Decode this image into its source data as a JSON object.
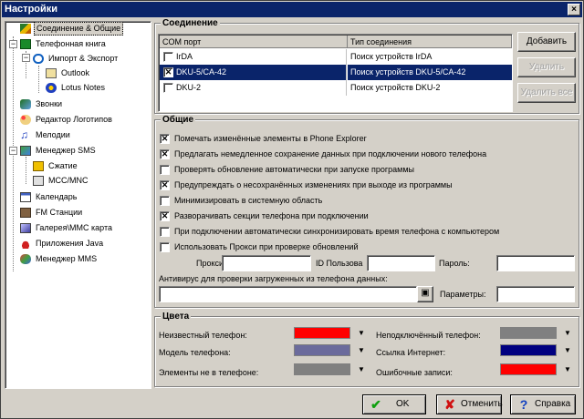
{
  "window": {
    "title": "Настройки",
    "close_glyph": "×"
  },
  "tree": {
    "items": [
      {
        "label": "Соединение & Общие",
        "icon": "pen-icon",
        "selected": true
      },
      {
        "label": "Телефонная книга",
        "icon": "phonebook-icon"
      },
      {
        "label": "Импорт & Экспорт",
        "icon": "import-export-icon"
      },
      {
        "label": "Outlook",
        "icon": "outlook-icon"
      },
      {
        "label": "Lotus Notes",
        "icon": "lotus-notes-icon"
      },
      {
        "label": "Звонки",
        "icon": "calls-icon"
      },
      {
        "label": "Редактор Логотипов",
        "icon": "palette-icon"
      },
      {
        "label": "Мелодии",
        "icon": "music-note-icon"
      },
      {
        "label": "Менеджер SMS",
        "icon": "sms-icon"
      },
      {
        "label": "Сжатие",
        "icon": "compression-icon"
      },
      {
        "label": "MCC/MNC",
        "icon": "monitor-icon"
      },
      {
        "label": "Календарь",
        "icon": "calendar-icon"
      },
      {
        "label": "FM Станции",
        "icon": "radio-icon"
      },
      {
        "label": "Галерея\\MMC карта",
        "icon": "gallery-icon"
      },
      {
        "label": "Приложения Java",
        "icon": "java-cup-icon"
      },
      {
        "label": "Менеджер MMS",
        "icon": "mms-icon"
      }
    ],
    "expander_minus": "−"
  },
  "connection": {
    "title": "Соединение",
    "columns": [
      "COM порт",
      "Тип соединения"
    ],
    "rows": [
      {
        "port": "IrDA",
        "type": "Поиск устройств IrDA",
        "checked": false,
        "selected": false
      },
      {
        "port": "DKU-5/CA-42",
        "type": "Поиск устройств DKU-5/CA-42",
        "checked": true,
        "selected": true
      },
      {
        "port": "DKU-2",
        "type": "Поиск устройств DKU-2",
        "checked": false,
        "selected": false
      }
    ],
    "buttons": {
      "add": "Добавить",
      "delete": "Удалить",
      "delete_all": "Удалить все"
    }
  },
  "general": {
    "title": "Общие",
    "options": [
      {
        "label": "Помечать изменённые элементы в Phone Explorer",
        "checked": true
      },
      {
        "label": "Предлагать немедленное сохранение данных при подключении нового телефона",
        "checked": true
      },
      {
        "label": "Проверять обновление автоматически при запуске программы",
        "checked": false
      },
      {
        "label": "Предупреждать о несохранённых изменениях при выходе из программы",
        "checked": true
      },
      {
        "label": "Минимизировать в системную область",
        "checked": false
      },
      {
        "label": "Разворачивать секции телефона при подключении",
        "checked": true
      },
      {
        "label": "При подключении автоматически синхронизировать время телефона с компьютером",
        "checked": false
      },
      {
        "label": "Использовать Прокси при проверке обновлений",
        "checked": false
      }
    ],
    "check_glyph": "✕",
    "proxy": {
      "proxy_label": "Прокси:",
      "id_label": "ID Пользова",
      "password_label": "Пароль:",
      "proxy_value": "",
      "id_value": "",
      "password_value": ""
    },
    "antivirus": {
      "label": "Антивирус для проверки загруженных из телефона данных:",
      "value": "",
      "params_label": "Параметры:",
      "params_value": "",
      "browse_icon": "folder-icon"
    }
  },
  "colors": {
    "title": "Цвета",
    "dropdown_glyph": "▼",
    "left": [
      {
        "label": "Неизвестный телефон:",
        "color": "#ff0000"
      },
      {
        "label": "Модель телефона:",
        "color": "#6b6b9c"
      },
      {
        "label": "Элементы не в телефоне:",
        "color": "#808080"
      }
    ],
    "right": [
      {
        "label": "Неподключённый телефон:",
        "color": "#808080"
      },
      {
        "label": "Ссылка Интернет:",
        "color": "#000080"
      },
      {
        "label": "Ошибочные записи:",
        "color": "#ff0000"
      }
    ]
  },
  "footer": {
    "ok": "OK",
    "ok_glyph": "✔",
    "cancel": "Отменить",
    "cancel_glyph": "✘",
    "help": "Справка",
    "help_glyph": "?"
  }
}
